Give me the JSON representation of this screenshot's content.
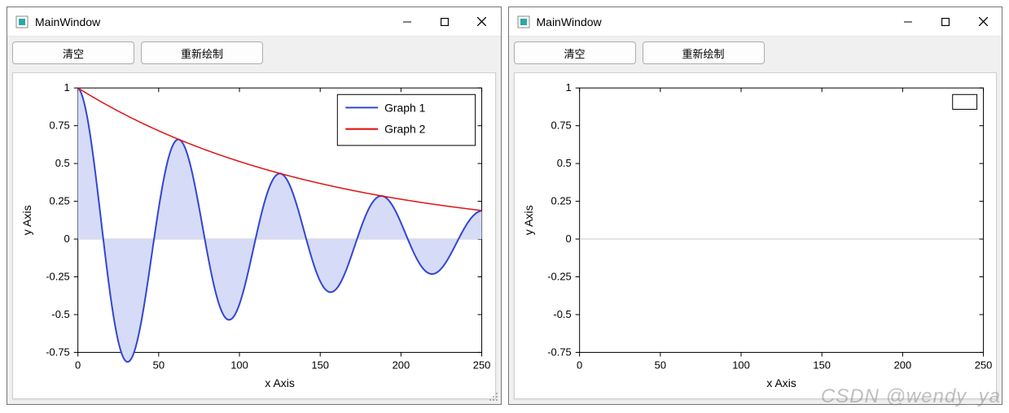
{
  "left_window": {
    "title": "MainWindow",
    "buttons": {
      "clear": "清空",
      "redraw": "重新绘制"
    },
    "legend": [
      "Graph 1",
      "Graph 2"
    ]
  },
  "right_window": {
    "title": "MainWindow",
    "buttons": {
      "clear": "清空",
      "redraw": "重新绘制"
    }
  },
  "watermark": "CSDN @wendy_ya",
  "chart_data": [
    {
      "type": "line",
      "title": "",
      "xlabel": "x Axis",
      "ylabel": "y Axis",
      "xlim": [
        0,
        250
      ],
      "ylim": [
        -0.75,
        1
      ],
      "xticks": [
        0,
        50,
        100,
        150,
        200,
        250
      ],
      "yticks": [
        -0.75,
        -0.5,
        -0.25,
        0,
        0.25,
        0.5,
        0.75,
        1
      ],
      "legend_position": "top-right",
      "grid": false,
      "series": [
        {
          "name": "Graph 1",
          "type": "area-line",
          "color": "#3246d3",
          "fill": "#d6dbf7",
          "description": "decaying oscillation y = exp(-x/150) * cos(x/10)",
          "x_sample": [
            0,
            16,
            31,
            47,
            63,
            79,
            94,
            110,
            126,
            141,
            157,
            173,
            188,
            204,
            220,
            236,
            251
          ],
          "y_sample": [
            1.0,
            -0.02,
            -0.81,
            -0.01,
            0.66,
            0.02,
            -0.53,
            -0.02,
            0.43,
            0.02,
            -0.35,
            -0.02,
            0.29,
            0.02,
            -0.23,
            -0.02,
            0.19
          ]
        },
        {
          "name": "Graph 2",
          "type": "line",
          "color": "#e11313",
          "description": "exponential decay envelope y = exp(-x/150)",
          "x_sample": [
            0,
            25,
            50,
            75,
            100,
            125,
            150,
            175,
            200,
            225,
            250
          ],
          "y_sample": [
            1.0,
            0.85,
            0.72,
            0.61,
            0.51,
            0.43,
            0.37,
            0.31,
            0.26,
            0.22,
            0.19
          ]
        }
      ]
    },
    {
      "type": "line",
      "title": "",
      "xlabel": "x Axis",
      "ylabel": "y Axis",
      "xlim": [
        0,
        250
      ],
      "ylim": [
        -0.75,
        1
      ],
      "xticks": [
        0,
        50,
        100,
        150,
        200,
        250
      ],
      "yticks": [
        -0.75,
        -0.5,
        -0.25,
        0,
        0.25,
        0.5,
        0.75,
        1
      ],
      "legend_position": "top-right",
      "grid": false,
      "series": []
    }
  ]
}
